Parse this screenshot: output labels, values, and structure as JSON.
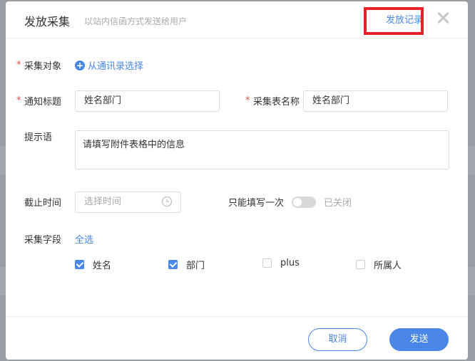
{
  "dialog": {
    "title": "发放采集",
    "subtitle": "以站内信函方式发送给用户",
    "record_link": "发放记录"
  },
  "form": {
    "target": {
      "label": "采集对象",
      "add_link": "从通讯录选择"
    },
    "notice_title": {
      "label": "通知标题",
      "value": "姓名部门"
    },
    "form_name": {
      "label": "采集表名称",
      "value": "姓名部门"
    },
    "prompt": {
      "label": "提示语",
      "value": "请填写附件表格中的信息"
    },
    "deadline": {
      "label": "截止时间",
      "placeholder": "选择时间"
    },
    "once_only": {
      "label": "只能填写一次",
      "state_text": "已关闭",
      "enabled": false
    },
    "fields": {
      "label": "采集字段",
      "select_all": "全选",
      "items": [
        {
          "label": "姓名",
          "checked": true
        },
        {
          "label": "部门",
          "checked": true
        },
        {
          "label": "plus",
          "checked": false
        },
        {
          "label": "所属人",
          "checked": false
        }
      ]
    }
  },
  "footer": {
    "cancel_label": "取消",
    "send_label": "发送"
  },
  "colors": {
    "accent": "#4a86e8",
    "required": "#f04b4b",
    "highlight": "#e8202a"
  }
}
